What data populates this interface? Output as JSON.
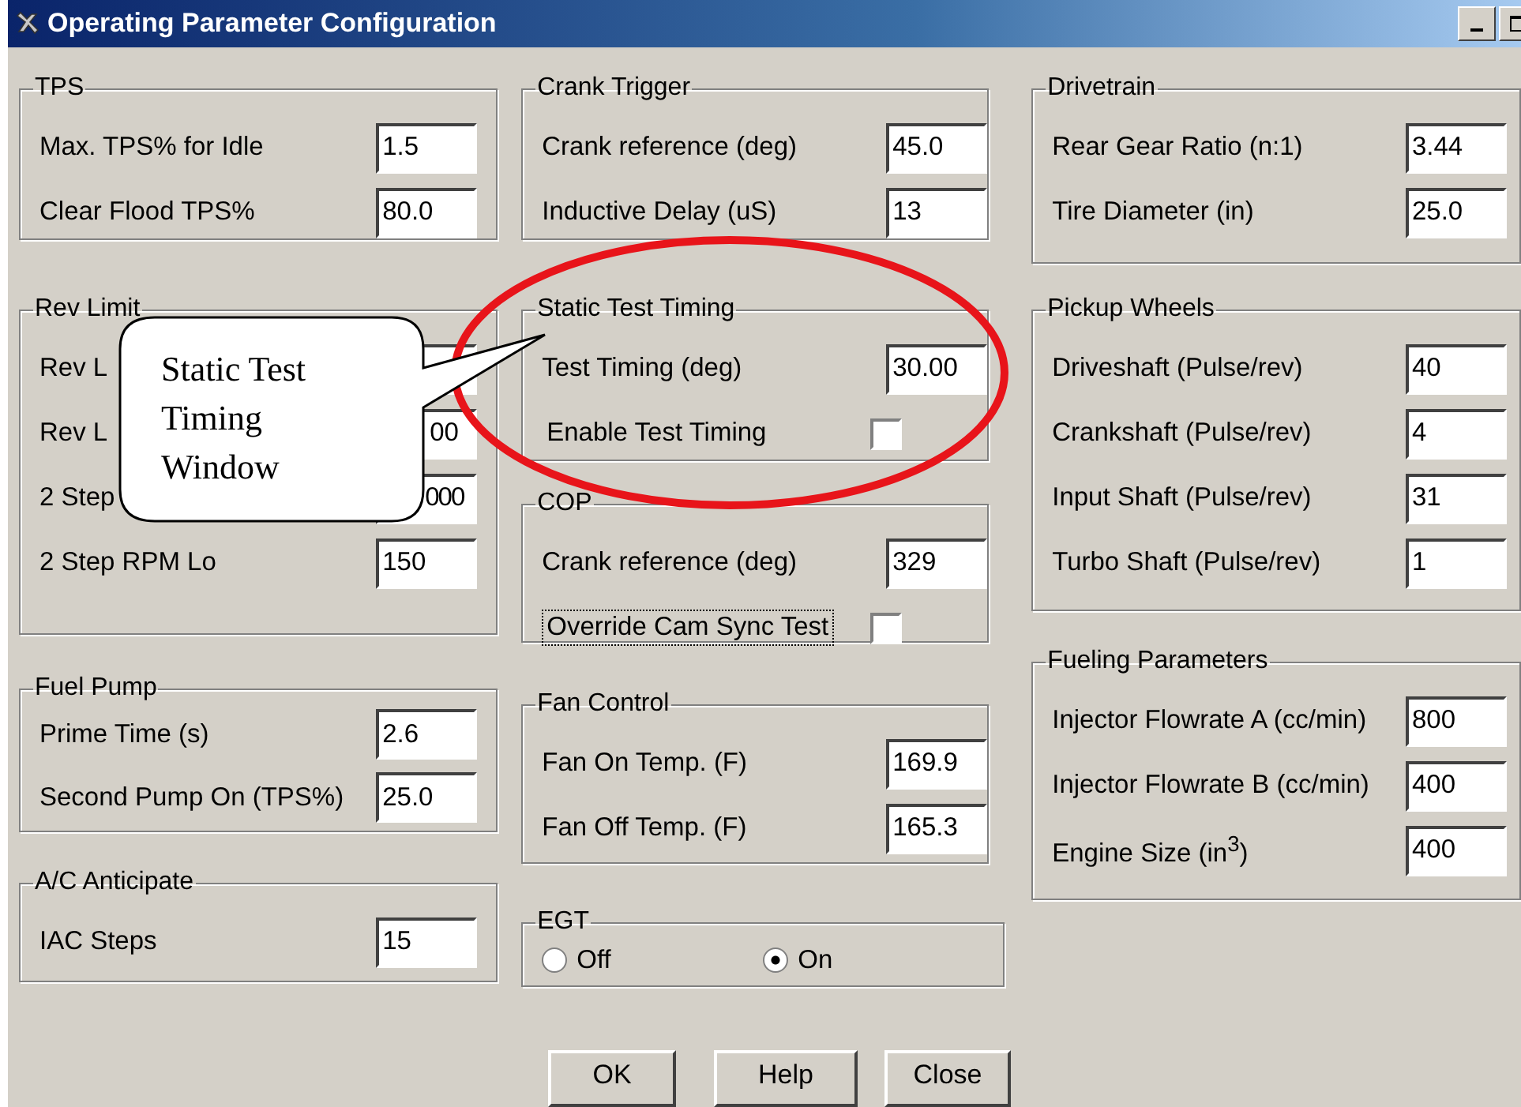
{
  "window": {
    "title": "Operating Parameter Configuration"
  },
  "columns": [
    [
      {
        "title": "TPS",
        "rows": [
          {
            "kind": "field",
            "label": "Max. TPS% for Idle",
            "value": "1.5"
          },
          {
            "kind": "field",
            "label": "Clear Flood TPS%",
            "value": "80.0"
          }
        ]
      },
      {
        "title": "Rev Limit",
        "rows": [
          {
            "kind": "field",
            "label": "Rev L"
          },
          {
            "kind": "field",
            "label": "Rev L",
            "value": "00"
          },
          {
            "kind": "field",
            "label": "2 Step",
            "value": "000"
          },
          {
            "kind": "field",
            "label": "2 Step RPM Lo",
            "value": "150"
          }
        ]
      },
      {
        "title": "Fuel Pump",
        "rows": [
          {
            "kind": "field",
            "label": "Prime Time (s)",
            "value": "2.6"
          },
          {
            "kind": "field",
            "label": "Second Pump On (TPS%)",
            "value": "25.0"
          }
        ]
      },
      {
        "title": "A/C Anticipate",
        "rows": [
          {
            "kind": "field",
            "label": "IAC Steps",
            "value": "15"
          }
        ]
      }
    ],
    [
      {
        "title": "Crank Trigger",
        "rows": [
          {
            "kind": "field",
            "label": "Crank reference (deg)",
            "value": "45.0"
          },
          {
            "kind": "field",
            "label": "Inductive Delay (uS)",
            "value": "13"
          }
        ]
      },
      {
        "title": "Static Test Timing",
        "rows": [
          {
            "kind": "field",
            "label": "Test Timing (deg)",
            "value": "30.00"
          },
          {
            "kind": "checkbox",
            "label": "Enable Test Timing",
            "checked": false,
            "focused": false
          }
        ]
      },
      {
        "title": "COP",
        "rows": [
          {
            "kind": "field",
            "label": "Crank reference (deg)",
            "value": "329"
          },
          {
            "kind": "checkbox",
            "label": "Override Cam Sync Test",
            "checked": false,
            "focused": true
          }
        ]
      },
      {
        "title": "Fan Control",
        "rows": [
          {
            "kind": "field",
            "label": "Fan On Temp. (F)",
            "value": "169.9"
          },
          {
            "kind": "field",
            "label": "Fan Off Temp. (F)",
            "value": "165.3"
          }
        ]
      },
      {
        "title": "EGT",
        "rows": [
          {
            "kind": "radio",
            "options": [
              {
                "label": "Off",
                "selected": false
              },
              {
                "label": "On",
                "selected": true
              }
            ]
          }
        ]
      }
    ],
    [
      {
        "title": "Drivetrain",
        "rows": [
          {
            "kind": "field",
            "label": "Rear Gear Ratio (n:1)",
            "value": "3.44"
          },
          {
            "kind": "field",
            "label": "Tire Diameter (in)",
            "value": "25.0"
          }
        ]
      },
      {
        "title": "Pickup Wheels",
        "rows": [
          {
            "kind": "field",
            "label": "Driveshaft (Pulse/rev)",
            "value": "40"
          },
          {
            "kind": "field",
            "label": "Crankshaft (Pulse/rev)",
            "value": "4"
          },
          {
            "kind": "field",
            "label": "Input Shaft (Pulse/rev)",
            "value": "31"
          },
          {
            "kind": "field",
            "label": "Turbo Shaft (Pulse/rev)",
            "value": "1"
          }
        ]
      },
      {
        "title": "Fueling Parameters",
        "rows": [
          {
            "kind": "field",
            "label": "Injector Flowrate A (cc/min)",
            "value": "800"
          },
          {
            "kind": "field",
            "label": "Injector Flowrate B (cc/min)",
            "value": "400"
          },
          {
            "kind": "field",
            "label": "Engine Size (in$^{3}$)",
            "value": "400"
          }
        ]
      }
    ]
  ],
  "buttons": [
    "OK",
    "Help",
    "Close"
  ],
  "annotation": {
    "text": "Static Test Timing Window"
  }
}
